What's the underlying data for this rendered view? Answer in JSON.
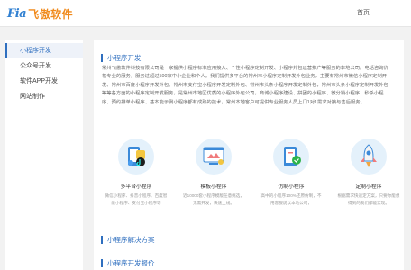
{
  "header": {
    "logo_mark": "Fia",
    "logo_text": "飞傲软件",
    "nav_home": "首页"
  },
  "sidebar": {
    "items": [
      {
        "label": "小程序开发",
        "active": true
      },
      {
        "label": "公众号开发",
        "active": false
      },
      {
        "label": "软件APP开发",
        "active": false
      },
      {
        "label": "网站制作",
        "active": false
      }
    ]
  },
  "main": {
    "section1_title": "小程序开发",
    "intro": "常州飞傲软件科技有限公司是一家提供小程序标准应用接入、个性小程序定制开发、小程序外包运营推广等服务的本地公司。电话咨询价格专业的服务，服务过超过500家中小企业和个人。我们提供多平台的常州市小程序定制开发外包业务，主要有常州市微信小程序定制开发、常州市百度小程序开发外包、常州市支付宝小程序开发定制外包、常州市头条小程序开发定制外包，常州市头条小程序定制开发外包等等各方面的小程序定制开发服务，是常州市地区优质的小程序外包公司，商城小程序建设、拼团的小程序、微分销小程序、秒杀小程序、预约排单小程序、基本能示例小程序都有成熟的技术，常州本地客户可提供专业服务人员上门1对1需求对接与售后服务。",
    "cards": [
      {
        "icon": "multi-platform-miniprogram-icon",
        "title": "多平台小程序",
        "desc": "微信小程序、抖音小程序、百度智能小程序、支付宝小程序等"
      },
      {
        "icon": "template-miniprogram-icon",
        "title": "模板小程序",
        "desc": "近10000套小程序模版任意挑选，无需开发，快速上线。"
      },
      {
        "icon": "custom-miniprogram-icon",
        "title": "仿制小程序",
        "desc": "高中的小程序100%还原仿制，不用客服说以本地公司，"
      },
      {
        "icon": "rocket-miniprogram-icon",
        "title": "定制小程序",
        "desc": "根据需求快速定方案，只要你能想得到的我们都能实现。"
      }
    ],
    "section2_title": "小程序解决方案",
    "section3_title": "小程序开发报价"
  },
  "colors": {
    "brand_blue": "#2f6fbf",
    "brand_orange": "#f08a1c",
    "circle_bg": "#e4f1fb"
  }
}
